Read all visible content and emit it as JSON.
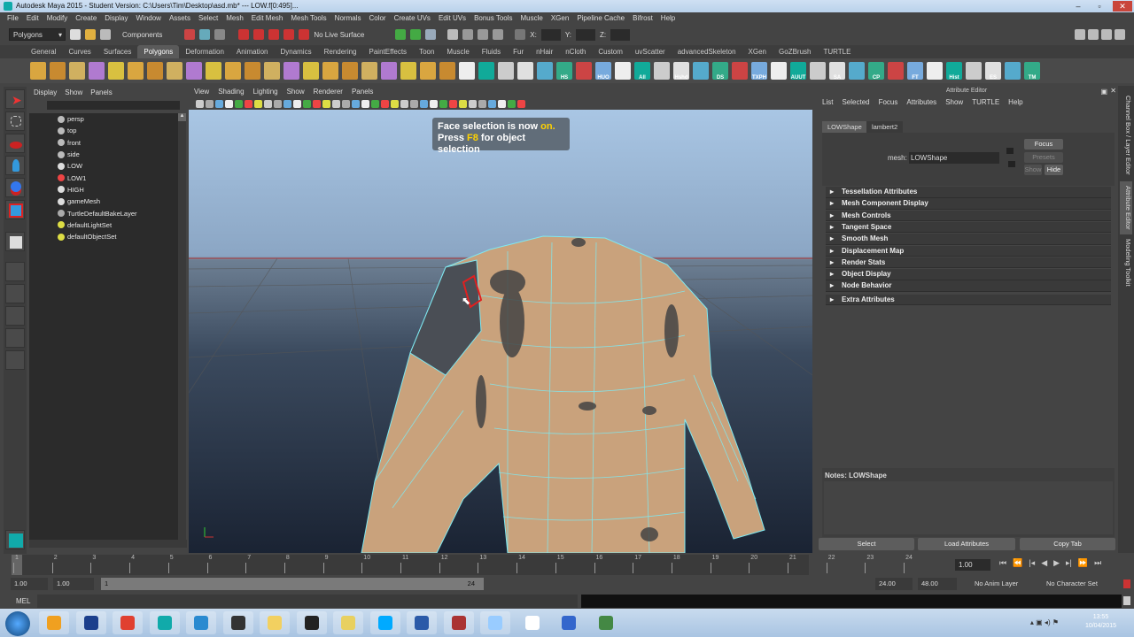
{
  "window": {
    "title": "Autodesk Maya 2015 - Student Version: C:\\Users\\Tim\\Desktop\\asd.mb*  ---  LOW.f[0:495]..."
  },
  "menu": [
    "File",
    "Edit",
    "Modify",
    "Create",
    "Display",
    "Window",
    "Assets",
    "Select",
    "Mesh",
    "Edit Mesh",
    "Mesh Tools",
    "Normals",
    "Color",
    "Create UVs",
    "Edit UVs",
    "Bonus Tools",
    "Muscle",
    "XGen",
    "Pipeline Cache",
    "Bifrost",
    "Help"
  ],
  "status": {
    "menuset": "Polygons",
    "components": "Components",
    "live": "No Live Surface",
    "x": "X:",
    "y": "Y:",
    "z": "Z:"
  },
  "shelf_tabs": [
    "General",
    "Curves",
    "Surfaces",
    "Polygons",
    "Deformation",
    "Animation",
    "Dynamics",
    "Rendering",
    "PaintEffects",
    "Toon",
    "Muscle",
    "Fluids",
    "Fur",
    "nHair",
    "nCloth",
    "Custom",
    "uvScatter",
    "advancedSkeleton",
    "XGen",
    "GoZBrush",
    "TURTLE"
  ],
  "shelf_active": "Polygons",
  "shelf_labels": [
    "HS",
    "HUO",
    "All",
    "Hshd",
    "DS",
    "TXPH",
    "AUUT",
    "SA",
    "CP",
    "FT",
    "Hist",
    "ES",
    "TM"
  ],
  "outliner": {
    "menu": [
      "Display",
      "Show",
      "Panels"
    ],
    "items": [
      "persp",
      "top",
      "front",
      "side",
      "LOW",
      "LOW1",
      "HIGH",
      "gameMesh",
      "TurtleDefaultBakeLayer",
      "defaultLightSet",
      "defaultObjectSet"
    ]
  },
  "viewport": {
    "menu": [
      "View",
      "Shading",
      "Lighting",
      "Show",
      "Renderer",
      "Panels"
    ],
    "help_line1_pre": "Face selection is now ",
    "help_line1_hl": "on.",
    "help_line2_pre": "Press ",
    "help_line2_hl": "F8",
    "help_line2_post": " for object selection"
  },
  "attr_editor": {
    "title": "Attribute Editor",
    "menu": [
      "List",
      "Selected",
      "Focus",
      "Attributes",
      "Show",
      "TURTLE",
      "Help"
    ],
    "tabs": [
      "LOWShape",
      "lambert2"
    ],
    "mesh_label": "mesh:",
    "mesh_value": "LOWShape",
    "focus": "Focus",
    "presets": "Presets",
    "show": "Show",
    "hide": "Hide",
    "sections": [
      "Tessellation Attributes",
      "Mesh Component Display",
      "Mesh Controls",
      "Tangent Space",
      "Smooth Mesh",
      "Displacement Map",
      "Render Stats",
      "Object Display",
      "Node Behavior",
      "Extra Attributes"
    ],
    "notes": "Notes: LOWShape",
    "buttons": [
      "Select",
      "Load Attributes",
      "Copy Tab"
    ]
  },
  "side_tabs": [
    "Channel Box / Layer Editor",
    "Attribute Editor",
    "Modeling Toolkit"
  ],
  "timeline": {
    "ticks": [
      "1",
      "2",
      "3",
      "4",
      "5",
      "6",
      "7",
      "8",
      "9",
      "10",
      "11",
      "12",
      "13",
      "14",
      "15",
      "16",
      "17",
      "18",
      "19",
      "20",
      "21",
      "22",
      "23",
      "24"
    ],
    "current": "1.00"
  },
  "range": {
    "start": "1.00",
    "start2": "1.00",
    "slider_start": "1",
    "slider_end": "24",
    "end": "24.00",
    "end2": "48.00",
    "anim_layer": "No Anim Layer",
    "char_set": "No Character Set"
  },
  "cmd": {
    "label": "MEL"
  },
  "clock": {
    "time": "13:55",
    "date": "10/04/2015"
  },
  "colors": {
    "wire": "#7fe8f0",
    "skin": "#c9a27c",
    "selected": "#e02020"
  }
}
